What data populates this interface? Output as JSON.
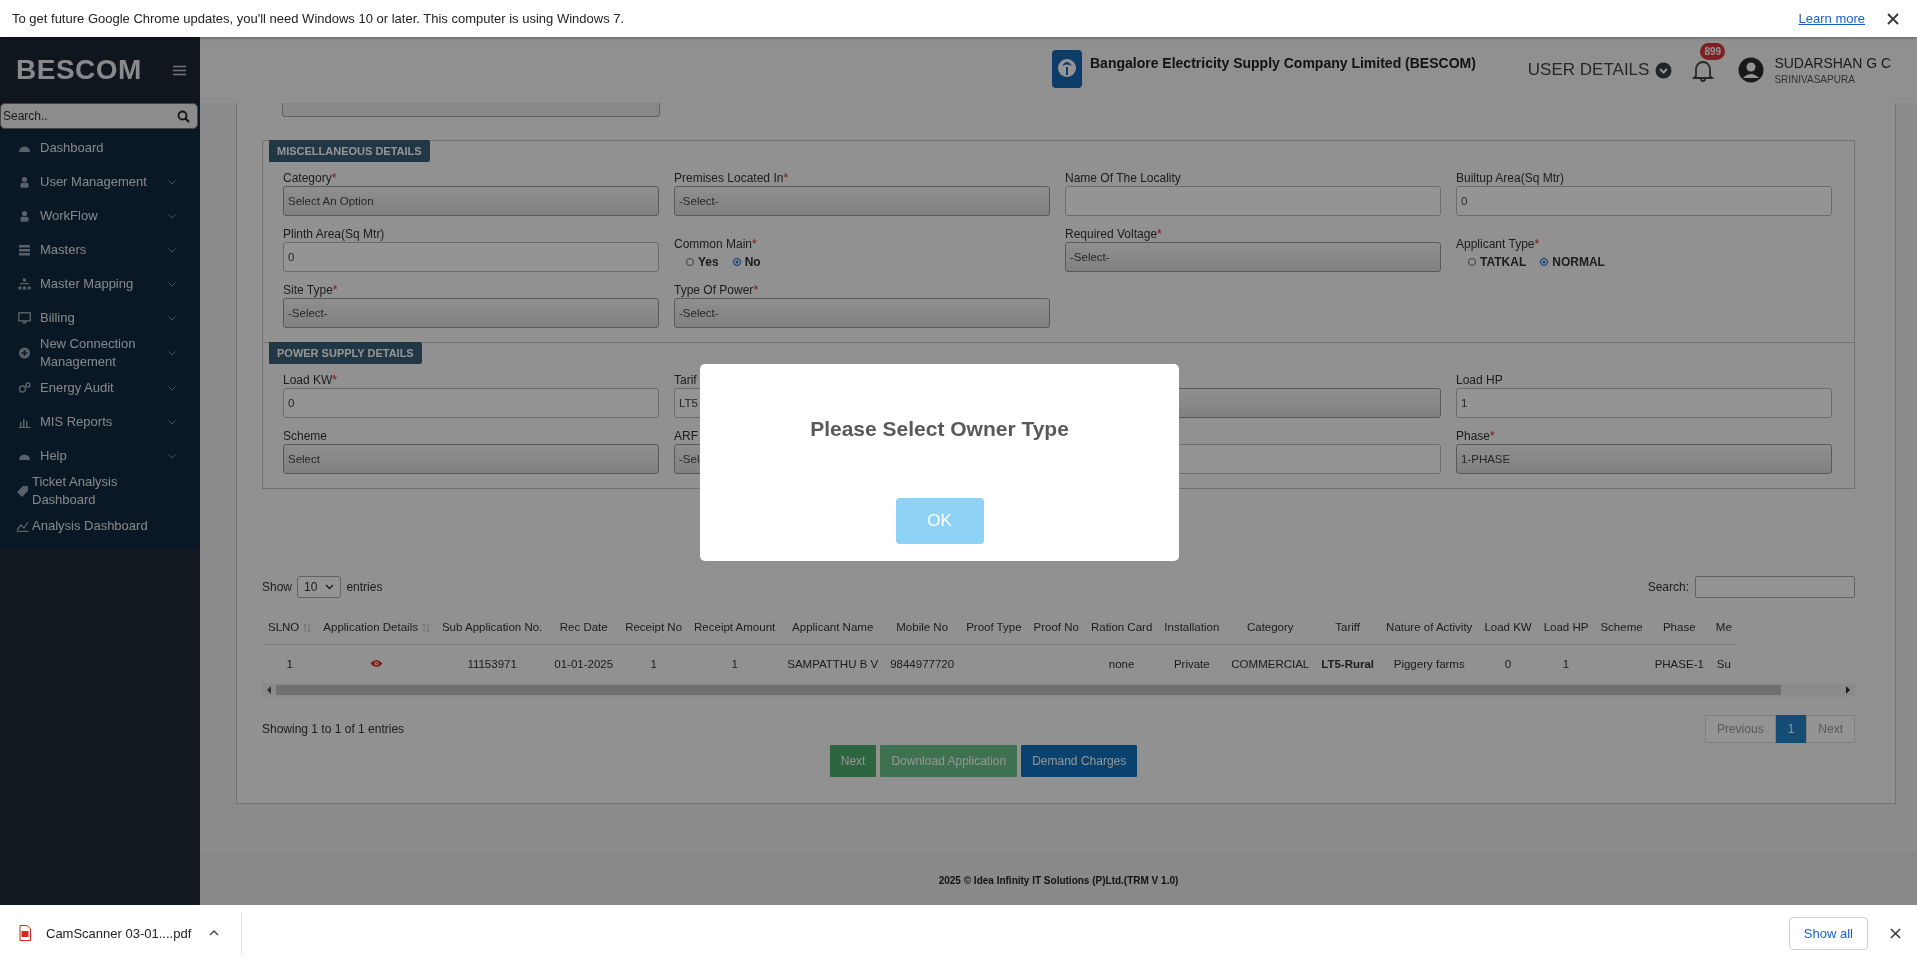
{
  "browser_bar": {
    "message": "To get future Google Chrome updates, you'll need Windows 10 or later. This computer is using Windows 7.",
    "link": "Learn more"
  },
  "sidebar": {
    "brand": "BESCOM",
    "search": {
      "placeholder": "Search.."
    },
    "items": [
      {
        "label": "Dashboard",
        "has_submenu": false,
        "nested": true
      },
      {
        "label": "User Management",
        "has_submenu": true,
        "nested": true
      },
      {
        "label": "WorkFlow",
        "has_submenu": true,
        "nested": true
      },
      {
        "label": "Masters",
        "has_submenu": true,
        "nested": true
      },
      {
        "label": "Master Mapping",
        "has_submenu": true,
        "nested": true
      },
      {
        "label": "Billing",
        "has_submenu": true,
        "nested": true
      },
      {
        "label": "New Connection Management",
        "has_submenu": true,
        "nested": true
      },
      {
        "label": "Energy Audit",
        "has_submenu": true,
        "nested": true
      },
      {
        "label": "MIS Reports",
        "has_submenu": true,
        "nested": true
      },
      {
        "label": "Help",
        "has_submenu": true,
        "nested": true
      },
      {
        "label": "Ticket Analysis Dashboard",
        "has_submenu": false,
        "nested": false
      },
      {
        "label": "Analysis Dashboard",
        "has_submenu": false,
        "nested": false
      }
    ]
  },
  "header": {
    "org_name": "Bangalore Electricity Supply Company Limited (BESCOM)",
    "user_menu": "USER DETAILS",
    "notification_count": "899",
    "user": {
      "name": "SUDARSHAN G C",
      "location": "SRINIVASAPURA"
    }
  },
  "sections": [
    {
      "title": "MISCELLANEOUS DETAILS",
      "fields": [
        {
          "kind": "select",
          "label": "Category",
          "mark": "*",
          "value": "Select An Option"
        },
        {
          "kind": "select",
          "label": "Premises Located In",
          "mark": "*",
          "value": "-Select-"
        },
        {
          "kind": "input",
          "label": "Name Of The Locality"
        },
        {
          "kind": "input",
          "label": "Builtup Area(Sq Mtr)",
          "value": "0"
        },
        {
          "kind": "input",
          "label": "Plinth Area(Sq Mtr)",
          "value": "0"
        },
        {
          "kind": "radio",
          "label": "Common Main",
          "mark": "*",
          "options": [
            {
              "label": "Yes",
              "selected": false
            },
            {
              "label": "No",
              "selected": true
            }
          ]
        },
        {
          "kind": "select",
          "label": "Required Voltage",
          "mark": "*",
          "value": "-Select-"
        },
        {
          "kind": "radio",
          "label": "Applicant Type",
          "mark": "*",
          "options": [
            {
              "label": "TATKAL",
              "selected": false
            },
            {
              "label": "NORMAL",
              "selected": true
            }
          ]
        },
        {
          "kind": "select",
          "label": "Site Type",
          "mark": "*",
          "value": "-Select-"
        },
        {
          "kind": "select",
          "label": "Type Of Power",
          "mark": "*",
          "value": "-Select-"
        }
      ]
    },
    {
      "title": "POWER SUPPLY DETAILS",
      "fields": [
        {
          "kind": "input",
          "label": "Load KW",
          "mark": "*",
          "value": "0"
        },
        {
          "kind": "input",
          "label": "Tarif",
          "value": "LT5"
        },
        {
          "kind": "select"
        },
        {
          "kind": "input",
          "label": "Load HP",
          "value": "1"
        },
        {
          "kind": "select",
          "label": "Scheme",
          "value": "Select"
        },
        {
          "kind": "select",
          "label": "ARF",
          "value": "-Sel"
        },
        {
          "kind": "input"
        },
        {
          "kind": "select",
          "label": "Phase",
          "mark": "*",
          "value": "1-PHASE"
        }
      ]
    }
  ],
  "table": {
    "show_label": "Show",
    "page_length": "10",
    "entries_label": "entries",
    "search_label": "Search:",
    "columns": [
      {
        "label": "SLNO",
        "sortable": true
      },
      {
        "label": "Application Details",
        "sortable": true
      },
      {
        "label": "Sub Application No.",
        "sortable": false
      },
      {
        "label": "Rec Date",
        "sortable": false
      },
      {
        "label": "Receipt No",
        "sortable": false
      },
      {
        "label": "Receipt Amount",
        "sortable": false
      },
      {
        "label": "Applicant Name",
        "sortable": false
      },
      {
        "label": "Mobile No",
        "sortable": false
      },
      {
        "label": "Proof Type",
        "sortable": false
      },
      {
        "label": "Proof No",
        "sortable": false
      },
      {
        "label": "Ration Card",
        "sortable": false
      },
      {
        "label": "Installation",
        "sortable": false
      },
      {
        "label": "Category",
        "sortable": false
      },
      {
        "label": "Tariff",
        "sortable": false
      },
      {
        "label": "Nature of Activity",
        "sortable": false
      },
      {
        "label": "Load KW",
        "sortable": false
      },
      {
        "label": "Load HP",
        "sortable": false
      },
      {
        "label": "Scheme",
        "sortable": false
      },
      {
        "label": "Phase",
        "sortable": false
      },
      {
        "label": "Me",
        "sortable": false
      }
    ],
    "rows": [
      {
        "cells": [
          {
            "kind": "text",
            "text": "1"
          },
          {
            "kind": "view_icon"
          },
          {
            "kind": "text",
            "text": "11153971"
          },
          {
            "kind": "text",
            "text": "01-01-2025"
          },
          {
            "kind": "text",
            "text": "1"
          },
          {
            "kind": "text",
            "text": "1"
          },
          {
            "kind": "text",
            "text": "SAMPATTHU B V"
          },
          {
            "kind": "text",
            "text": "9844977720"
          },
          {
            "kind": "empty"
          },
          {
            "kind": "empty"
          },
          {
            "kind": "text",
            "text": "none"
          },
          {
            "kind": "text",
            "text": "Private"
          },
          {
            "kind": "text",
            "text": "COMMERCIAL"
          },
          {
            "kind": "bold",
            "text": "LT5-Rural"
          },
          {
            "kind": "text",
            "text": "Piggery farms"
          },
          {
            "kind": "text",
            "text": "0"
          },
          {
            "kind": "text",
            "text": "1"
          },
          {
            "kind": "empty"
          },
          {
            "kind": "text",
            "text": "PHASE-1"
          },
          {
            "kind": "text",
            "text": "Su"
          }
        ]
      }
    ],
    "info": "Showing 1 to 1 of 1 entries",
    "pagination": [
      {
        "label": "Previous",
        "selected": false,
        "disabled": true
      },
      {
        "label": "1",
        "selected": true,
        "disabled": false
      },
      {
        "label": "Next",
        "selected": false,
        "disabled": true
      }
    ]
  },
  "actions": [
    {
      "label": "Next",
      "kind": "success"
    },
    {
      "label": "Download Application",
      "kind": "success_light"
    },
    {
      "label": "Demand Charges",
      "kind": "primary"
    }
  ],
  "footer": "2025 © Idea Infinity IT Solutions (P)Ltd.(TRM V 1.0)",
  "modal": {
    "message": "Please Select Owner Type",
    "button": "OK"
  },
  "download_bar": {
    "file": "CamScanner 03-01....pdf",
    "show_all": "Show all"
  }
}
